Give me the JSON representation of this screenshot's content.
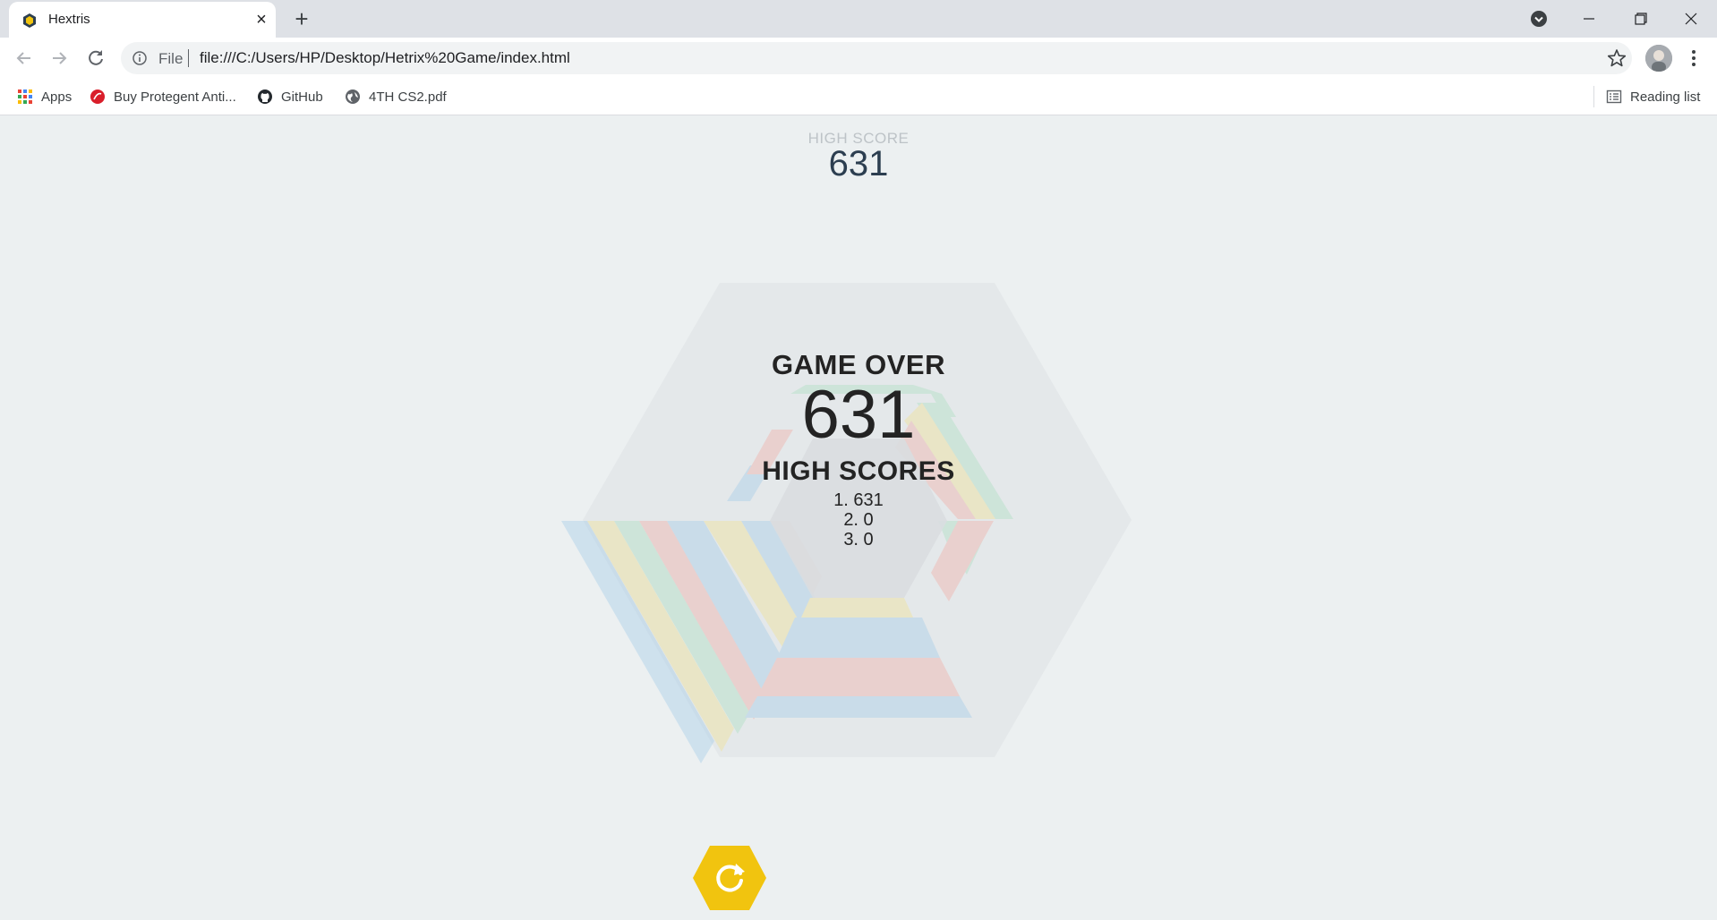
{
  "browser": {
    "tab_title": "Hextris",
    "url_scheme": "File",
    "url": "file:///C:/Users/HP/Desktop/Hetrix%20Game/index.html",
    "bookmarks": [
      {
        "label": "Apps",
        "icon": "apps-grid-icon"
      },
      {
        "label": "Buy Protegent Anti...",
        "icon": "protegent-icon"
      },
      {
        "label": "GitHub",
        "icon": "github-icon"
      },
      {
        "label": "4TH CS2.pdf",
        "icon": "globe-icon"
      }
    ],
    "reading_list": "Reading list"
  },
  "game": {
    "high_score_label": "HIGH SCORE",
    "high_score_value": "631",
    "game_over_title": "GAME OVER",
    "final_score": "631",
    "high_scores_title": "HIGH SCORES",
    "high_scores": [
      "1. 631",
      "2. 0",
      "3. 0"
    ]
  },
  "colors": {
    "background": "#ecf0f1",
    "restart_button": "#f1c40f",
    "block_red": "#e74c3c",
    "block_yellow": "#f1c40f",
    "block_blue": "#3498db",
    "block_green": "#2ecc71"
  }
}
